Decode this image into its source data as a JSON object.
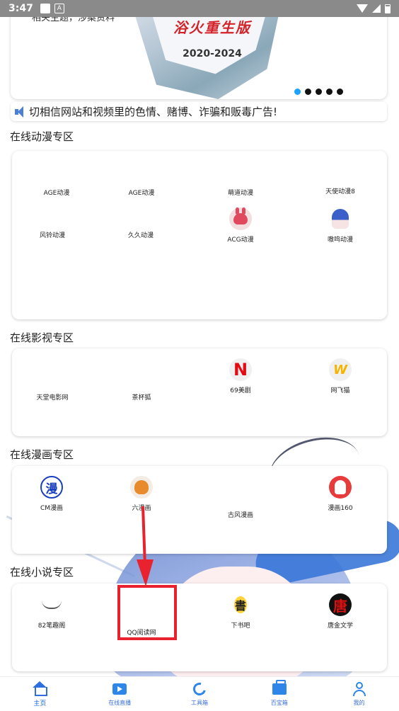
{
  "status_bar": {
    "time": "3:47",
    "notif_a": "A"
  },
  "banner": {
    "title": "浴火重生版",
    "year": "2020-2024",
    "left_text": "相关主题，涉案资料",
    "dots": 5,
    "active_dot": 0
  },
  "notice": {
    "text": "切相信网站和视频里的色情、赌博、诈骗和贩毒广告!"
  },
  "sections": [
    {
      "title": "在线动漫专区"
    },
    {
      "title": "在线影视专区"
    },
    {
      "title": "在线漫画专区"
    },
    {
      "title": "在线小说专区"
    }
  ],
  "anime": {
    "items": [
      {
        "label": "AGE动漫",
        "icon": "none"
      },
      {
        "label": "AGE动漫",
        "icon": "none"
      },
      {
        "label": "萌道动漫",
        "icon": "none"
      },
      {
        "label": "天使动漫8",
        "icon": "none"
      },
      {
        "label": "风铃动漫",
        "icon": "none"
      },
      {
        "label": "久久动漫",
        "icon": "none"
      },
      {
        "label": "ACG动漫",
        "icon": "rabbit-icon"
      },
      {
        "label": "嗷呜动漫",
        "icon": "anime-girl-icon"
      }
    ]
  },
  "video": {
    "items": [
      {
        "label": "天堂电影网",
        "icon": "none"
      },
      {
        "label": "茶杯狐",
        "icon": "none"
      },
      {
        "label": "69美剧",
        "icon": "netflix-icon",
        "glyph": "N"
      },
      {
        "label": "网飞猫",
        "icon": "w-logo-icon",
        "glyph": "W"
      }
    ]
  },
  "comic": {
    "items": [
      {
        "label": "CM漫画",
        "icon": "man-character-icon",
        "glyph": "漫"
      },
      {
        "label": "六漫画",
        "icon": "cartoon-character-icon"
      },
      {
        "label": "古风漫画",
        "icon": "none"
      },
      {
        "label": "漫画160",
        "icon": "bunny-icon"
      }
    ]
  },
  "novel": {
    "items": [
      {
        "label": "82笔趣阁",
        "icon": "mustache-icon"
      },
      {
        "label": "QQ阅读网",
        "icon": "none"
      },
      {
        "label": "下书吧",
        "icon": "xiashu-logo-icon",
        "glyph": "書"
      },
      {
        "label": "唐金文学",
        "icon": "tang-logo-icon",
        "glyph": "唐"
      }
    ]
  },
  "bottom_nav": [
    {
      "label": "主页",
      "icon": "home-icon"
    },
    {
      "label": "在线直播",
      "icon": "live-play-icon"
    },
    {
      "label": "工具箱",
      "icon": "toolbox-icon"
    },
    {
      "label": "百宝箱",
      "icon": "treasure-box-icon"
    },
    {
      "label": "我的",
      "icon": "user-icon"
    }
  ],
  "colors": {
    "accent": "#19a3ff",
    "annotation": "#e8232f",
    "nav": "#2d86e8"
  }
}
